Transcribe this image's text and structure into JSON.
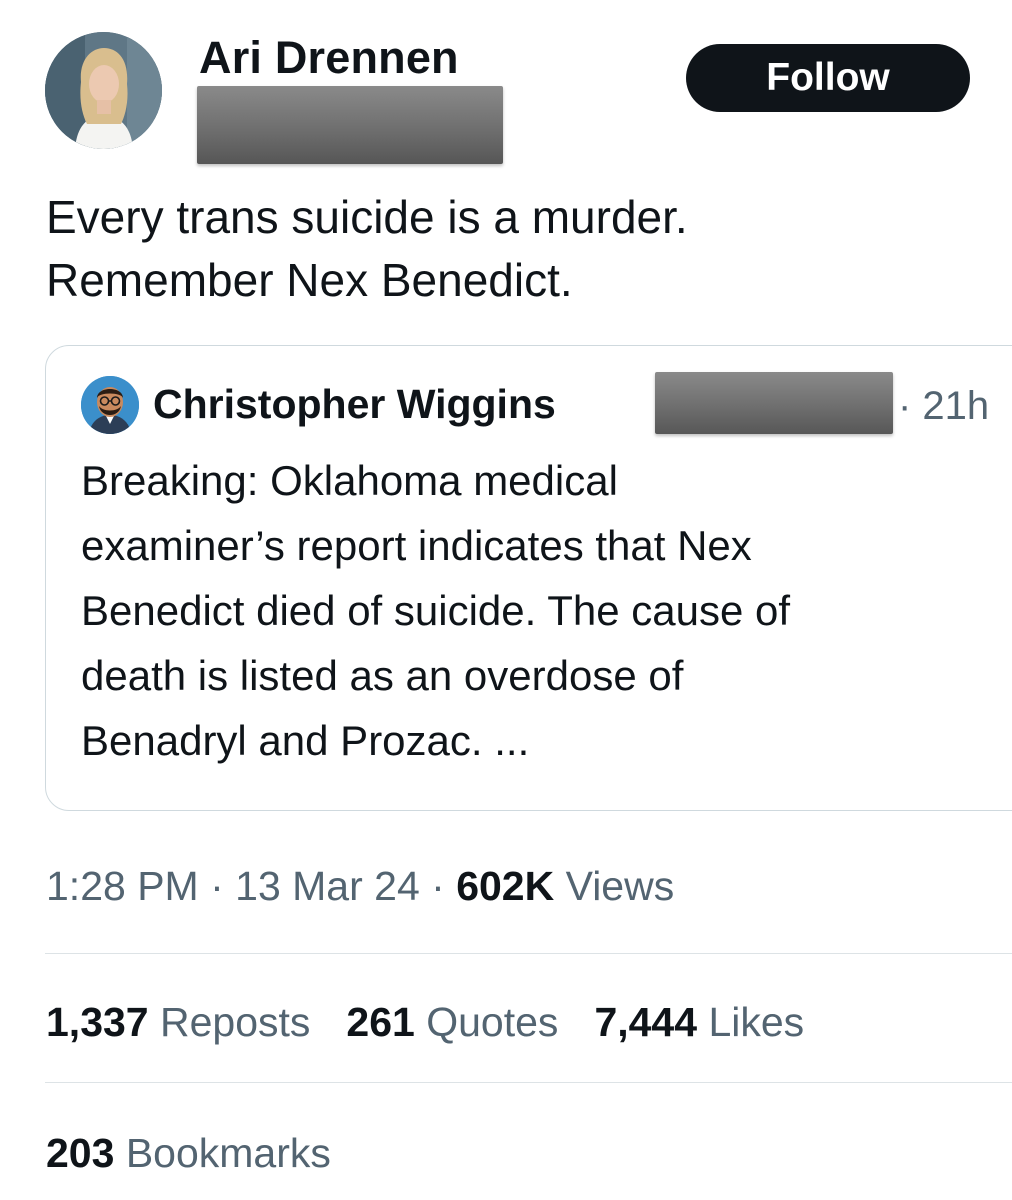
{
  "author": {
    "display_name": "Ari Drennen",
    "follow_label": "Follow"
  },
  "tweet": {
    "text_lines": [
      "Every trans suicide is a murder.",
      "Remember Nex Benedict."
    ]
  },
  "quoted_tweet": {
    "author_name": "Christopher Wiggins",
    "time": "· 21h",
    "text_lines": [
      "Breaking: Oklahoma medical",
      "examiner’s report indicates that Nex",
      "Benedict died of suicide. The cause of",
      "death is listed as an overdose of",
      "Benadryl and Prozac. ..."
    ]
  },
  "meta": {
    "time": "1:28 PM",
    "sep1": " · ",
    "date": "13 Mar 24",
    "sep2": " · ",
    "views_count": "602K",
    "views_label": " Views"
  },
  "stats": {
    "reposts": {
      "count": "1,337",
      "label": " Reposts"
    },
    "quotes": {
      "count": "261",
      "label": " Quotes"
    },
    "likes": {
      "count": "7,444",
      "label": " Likes"
    },
    "bookmarks": {
      "count": "203",
      "label": " Bookmarks"
    }
  },
  "colors": {
    "text_primary": "#0f1419",
    "text_secondary": "#536471",
    "border": "#cfd9de",
    "follow_bg": "#0f1419",
    "redaction": "#6f6f6f"
  },
  "icons": {
    "author_avatar": "profile-photo",
    "quote_avatar": "cartoon-avatar"
  }
}
